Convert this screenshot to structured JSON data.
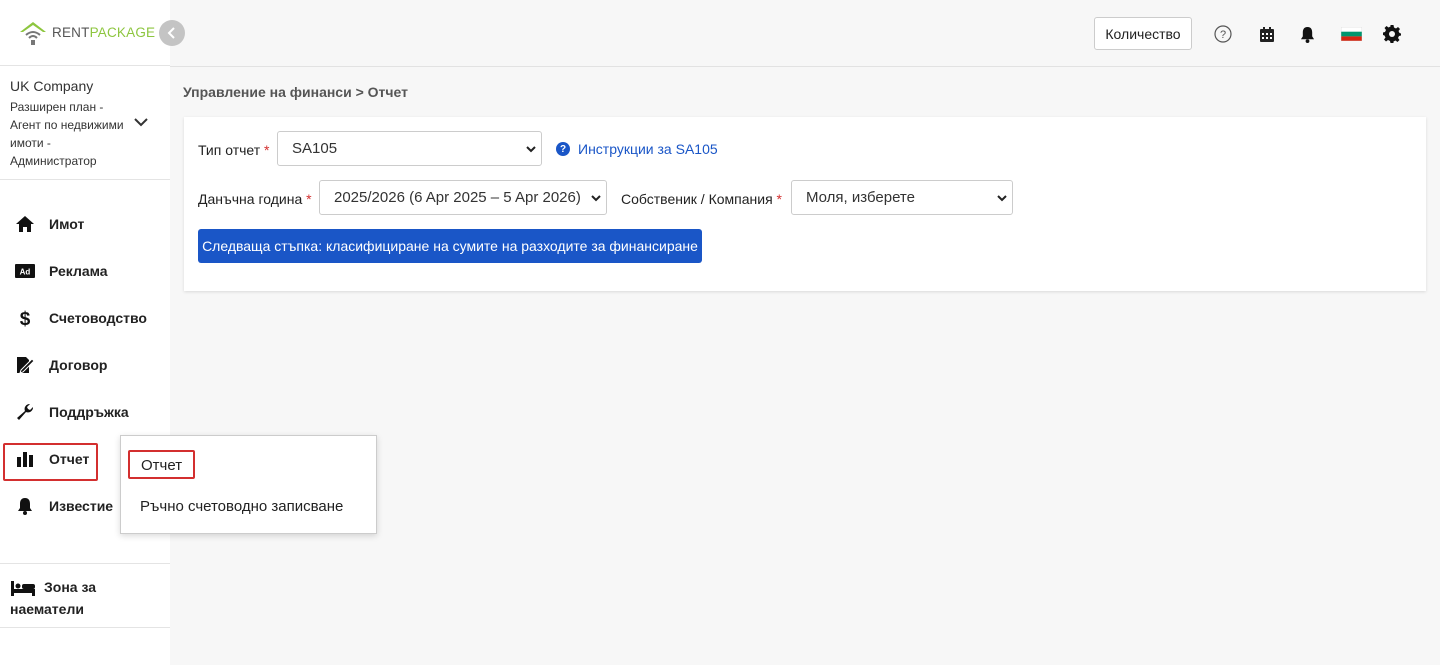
{
  "brand": {
    "rent": "RENT",
    "package": "PACKAGE"
  },
  "company": {
    "name": "UK Company",
    "plan": "Разширен план - Агент по недвижими имоти - Администратор"
  },
  "nav": {
    "items": [
      {
        "label": "Имот",
        "icon": "home-icon"
      },
      {
        "label": "Реклама",
        "icon": "ad-icon"
      },
      {
        "label": "Счетоводство",
        "icon": "dollar-icon"
      },
      {
        "label": "Договор",
        "icon": "contract-icon"
      },
      {
        "label": "Поддръжка",
        "icon": "wrench-icon"
      },
      {
        "label": "Отчет",
        "icon": "bar-chart-icon"
      },
      {
        "label": "Известие",
        "icon": "bell-icon"
      }
    ],
    "tenant_zone": "Зона за наематели"
  },
  "submenu": {
    "items": [
      "Отчет",
      "Ръчно счетоводно записване"
    ]
  },
  "topbar": {
    "quantity_label": "Количество"
  },
  "breadcrumb": "Управление на финанси > Отчет",
  "form": {
    "report_type_label": "Тип отчет",
    "report_type_value": "SA105",
    "help_link": "Инструкции за SA105",
    "tax_year_label": "Данъчна година",
    "tax_year_value": "2025/2026 (6 Apr 2025 – 5 Apr 2026)",
    "owner_label": "Собственик / Компания",
    "owner_value": "Моля, изберете",
    "required_mark": "*",
    "next_button": "Следваща стъпка: класифициране на сумите на разходите за финансиране"
  },
  "colors": {
    "accent": "#1a56c7",
    "brand_green": "#8dc63f",
    "highlight": "#d32f2f"
  }
}
